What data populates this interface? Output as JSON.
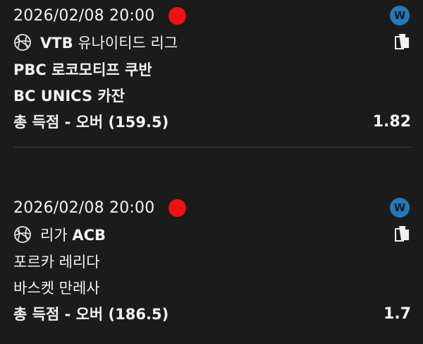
{
  "bets": [
    {
      "datetime": "2026/02/08 20:00",
      "badge": "W",
      "league_prefix": "VTB",
      "league_suffix": " 유나이티드 리그",
      "home_team": "PBC 로코모티프 쿠반",
      "away_team": "BC UNICS 카잔",
      "market": "총 득점 - 오버 (159.5)",
      "odds": "1.82"
    },
    {
      "datetime": "2026/02/08 20:00",
      "badge": "W",
      "league_prefix": "리가 ",
      "league_suffix": "ACB",
      "home_team": "포르카 레리다",
      "away_team": "바스켓 만레사",
      "market": "총 득점 - 오버 (186.5)",
      "odds": "1.7"
    }
  ],
  "icons": {
    "sport": "basketball-icon",
    "copy": "copy-icon",
    "live": "live-indicator",
    "badge": "w-badge"
  },
  "colors": {
    "background": "#1b1b1b",
    "live_dot": "#ee1111",
    "badge": "#2878b8",
    "text": "#f2f2f2"
  }
}
